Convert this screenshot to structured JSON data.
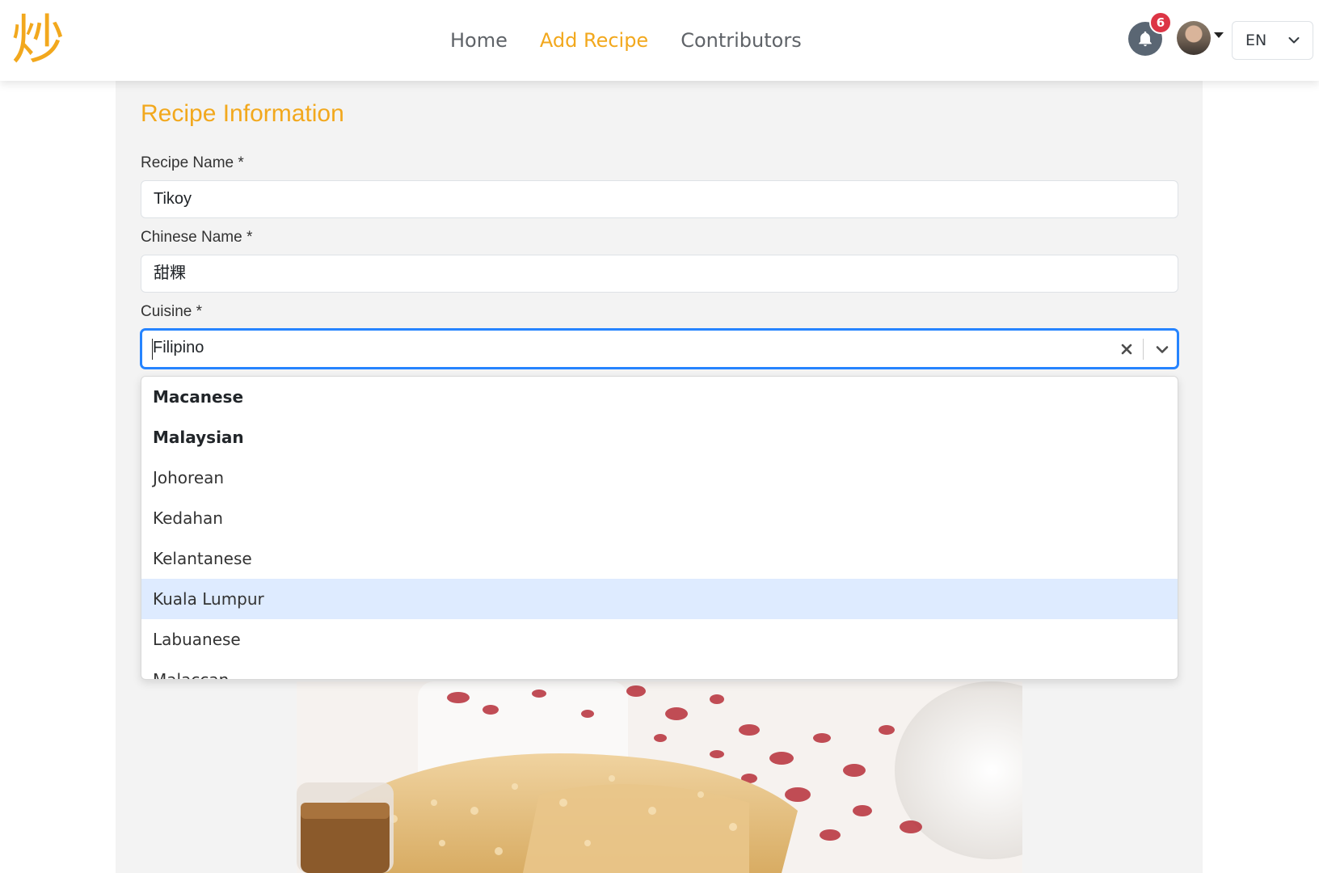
{
  "header": {
    "logo_char": "炒",
    "nav": [
      {
        "label": "Home",
        "active": false
      },
      {
        "label": "Add Recipe",
        "active": true
      },
      {
        "label": "Contributors",
        "active": false
      }
    ],
    "notifications_count": "6",
    "language": "EN",
    "accent_color": "#f2a81d"
  },
  "form": {
    "section_title": "Recipe Information",
    "recipe_name_label": "Recipe Name *",
    "recipe_name_value": "Tikoy",
    "chinese_name_label": "Chinese Name *",
    "chinese_name_value": "甜粿",
    "cuisine_label": "Cuisine *",
    "cuisine_value": "Filipino"
  },
  "cuisine_menu": {
    "options": [
      {
        "label": "Macanese",
        "group": true
      },
      {
        "label": "Malaysian",
        "group": true
      },
      {
        "label": "Johorean",
        "group": false
      },
      {
        "label": "Kedahan",
        "group": false
      },
      {
        "label": "Kelantanese",
        "group": false
      },
      {
        "label": "Kuala Lumpur",
        "group": false,
        "focused": true
      },
      {
        "label": "Labuanese",
        "group": false
      },
      {
        "label": "Malaccan",
        "group": false
      }
    ]
  }
}
